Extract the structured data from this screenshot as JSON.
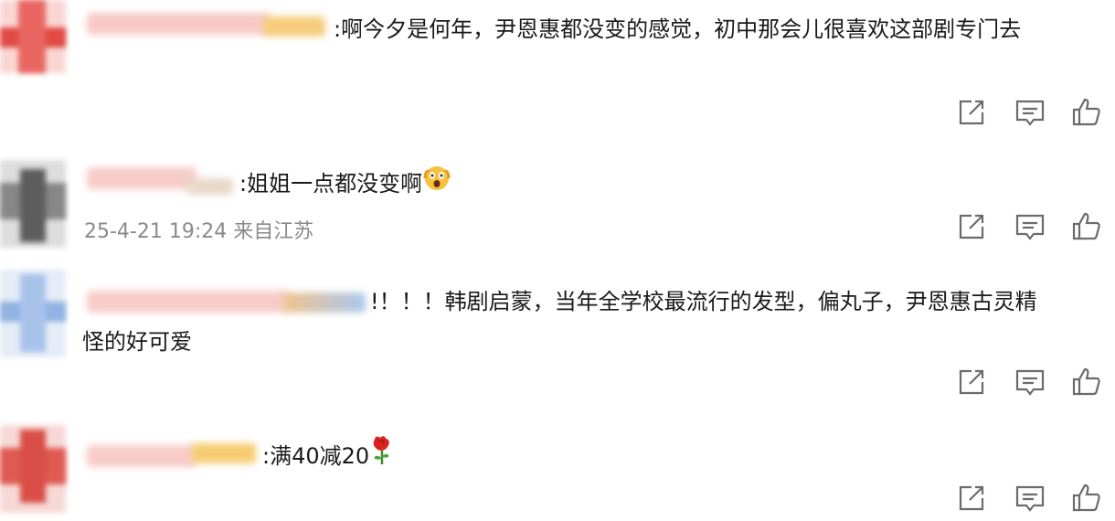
{
  "comments": [
    {
      "text": ":啊今夕是何年，尹恩惠都没变的感觉，初中那会儿很喜欢这部剧专门去",
      "meta": "",
      "emoji": ""
    },
    {
      "text": ":姐姐一点都没变啊",
      "meta": "25-4-21 19:24 来自江苏",
      "emoji": "scared-face-emoji"
    },
    {
      "text": "!！！！韩剧启蒙，当年全学校最流行的发型，偏丸子，尹恩惠古灵精",
      "text2": "怪的好可爱",
      "meta": "",
      "emoji": ""
    },
    {
      "text": ":满40减20",
      "meta": "",
      "emoji": "rose-emoji"
    }
  ],
  "actions": {
    "share_icon": "share-icon",
    "comment_icon": "comment-icon",
    "like_icon": "thumbs-up-icon"
  },
  "colors": {
    "icon": "#6b6b6b",
    "text": "#1a1a1a",
    "meta": "#8a8a8a"
  }
}
